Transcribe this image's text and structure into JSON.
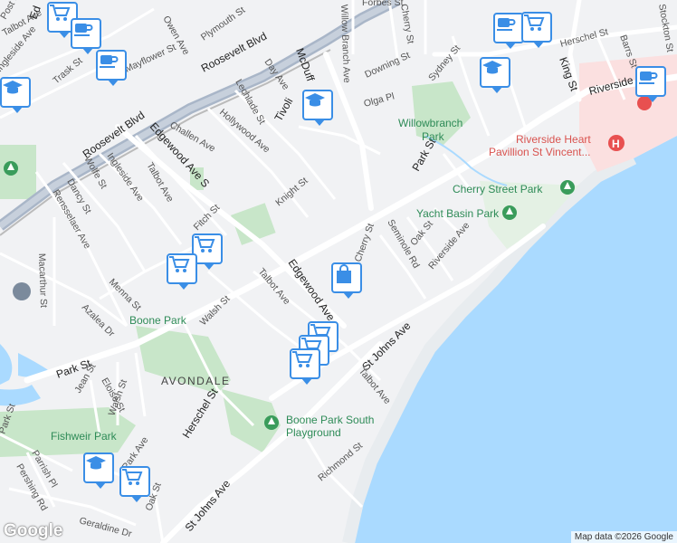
{
  "map": {
    "streets": {
      "post_st": "Post St",
      "ed": "Ed",
      "talbot_ave_nw": "Talbot Ave",
      "ingleside_ave_nw": "Ingleside Ave",
      "trask_st": "Trask St",
      "owen_ave": "Owen Ave",
      "plymouth_st": "Plymouth St",
      "roosevelt_blvd_top": "Roosevelt Blvd",
      "mayflower_st": "Mayflower St",
      "lechlade_st": "Lechlade St",
      "day_ave": "Day Ave",
      "mcduff": "McDuff",
      "willow_branch_ave": "Willow Branch Ave",
      "forbes_st": "Forbes St",
      "cherry_st_top": "Cherry St",
      "stockton_st": "Stockton St",
      "herschel_st_top": "Herschel St",
      "barrs_st": "Barrs St",
      "king_st": "King St",
      "riverside": "Riverside",
      "downing_st": "Downing St",
      "sydney_st": "Sydney St",
      "olga_pl": "Olga Pl",
      "tivoli": "Tivoli",
      "hollywood_ave": "Hollywood Ave",
      "challen_ave": "Challen Ave",
      "roosevelt_blvd_left": "Roosevelt Blvd",
      "edgewood_ave_s": "Edgewood Ave S",
      "wolfe_st": "Wolfe St",
      "ingleside_ave": "Ingleside Ave",
      "talbot_ave_w": "Talbot Ave",
      "dancy_st": "Dancy St",
      "rensselaer_ave": "Rensselaer Ave",
      "knight_st": "Knight St",
      "fitch_st": "Fitch St",
      "park_st_ne": "Park St",
      "seminole_rd": "Seminole Rd",
      "oak_st_e": "Oak St",
      "riverside_ave": "Riverside Ave",
      "cherry_st_mid": "Cherry St",
      "macarthur_st": "Macarthur St",
      "menna_st": "Menna St",
      "azalea_dr": "Azalea Dr",
      "walsh_st_mid": "Walsh St",
      "talbot_ave_mid": "Talbot Ave",
      "edgewood_ave": "Edgewood Ave",
      "st_johns_ave_mid": "St Johns Ave",
      "park_st_w": "Park St",
      "jean_st": "Jean St",
      "eloise_st": "Eloise St",
      "walsh_st_low": "Walsh St",
      "herschel_st": "Herschel St",
      "talbot_ave_low": "Talbot Ave",
      "park_st_sw": "Park St",
      "park_ave": "Park Ave",
      "parrish_pl": "Parrish Pl",
      "pershing_rd": "Pershing Rd",
      "oak_st_s": "Oak St",
      "st_johns_ave_low": "St Johns Ave",
      "richmond_st": "Richmond St",
      "geraldine_dr": "Geraldine Dr"
    },
    "parks": {
      "willowbranch_1": "Willowbranch",
      "willowbranch_2": "Park",
      "cherry_street_park": "Cherry Street Park",
      "yacht_basin_park": "Yacht Basin Park",
      "boone_park": "Boone Park",
      "boone_park_south_1": "Boone Park South",
      "boone_park_south_2": "Playground",
      "fishweir_park": "Fishweir Park"
    },
    "pois": {
      "hospital_1": "Riverside Heart",
      "hospital_2": "Pavillion St Vincent..."
    },
    "area": "AVONDALE",
    "colors": {
      "water": "#aadaff",
      "park": "#c8e6c9",
      "road": "#ffffff",
      "highway": "#a9b6c8",
      "marker_border": "#3a8ee6",
      "hospital_area": "#fbe0e0",
      "park_text": "#2e8b57",
      "hospital_text": "#d9534f"
    },
    "markers": [
      {
        "type": "grocery",
        "icon": "shopping-cart-icon"
      },
      {
        "type": "cafe",
        "icon": "coffee-cup-icon"
      },
      {
        "type": "cafe",
        "icon": "coffee-cup-icon"
      },
      {
        "type": "school",
        "icon": "graduation-cap-icon"
      },
      {
        "type": "school",
        "icon": "graduation-cap-icon"
      },
      {
        "type": "cafe",
        "icon": "coffee-cup-icon"
      },
      {
        "type": "grocery",
        "icon": "shopping-cart-icon"
      },
      {
        "type": "school",
        "icon": "graduation-cap-icon"
      },
      {
        "type": "cafe",
        "icon": "coffee-cup-icon"
      },
      {
        "type": "grocery",
        "icon": "shopping-cart-icon"
      },
      {
        "type": "grocery",
        "icon": "shopping-cart-icon"
      },
      {
        "type": "shopping",
        "icon": "shopping-bag-icon"
      },
      {
        "type": "grocery",
        "icon": "shopping-cart-icon"
      },
      {
        "type": "grocery",
        "icon": "shopping-cart-icon"
      },
      {
        "type": "grocery",
        "icon": "shopping-cart-icon"
      },
      {
        "type": "school",
        "icon": "graduation-cap-icon"
      },
      {
        "type": "grocery",
        "icon": "shopping-cart-icon"
      }
    ]
  },
  "footer": {
    "logo": "Google",
    "attribution": "Map data ©2026 Google"
  }
}
